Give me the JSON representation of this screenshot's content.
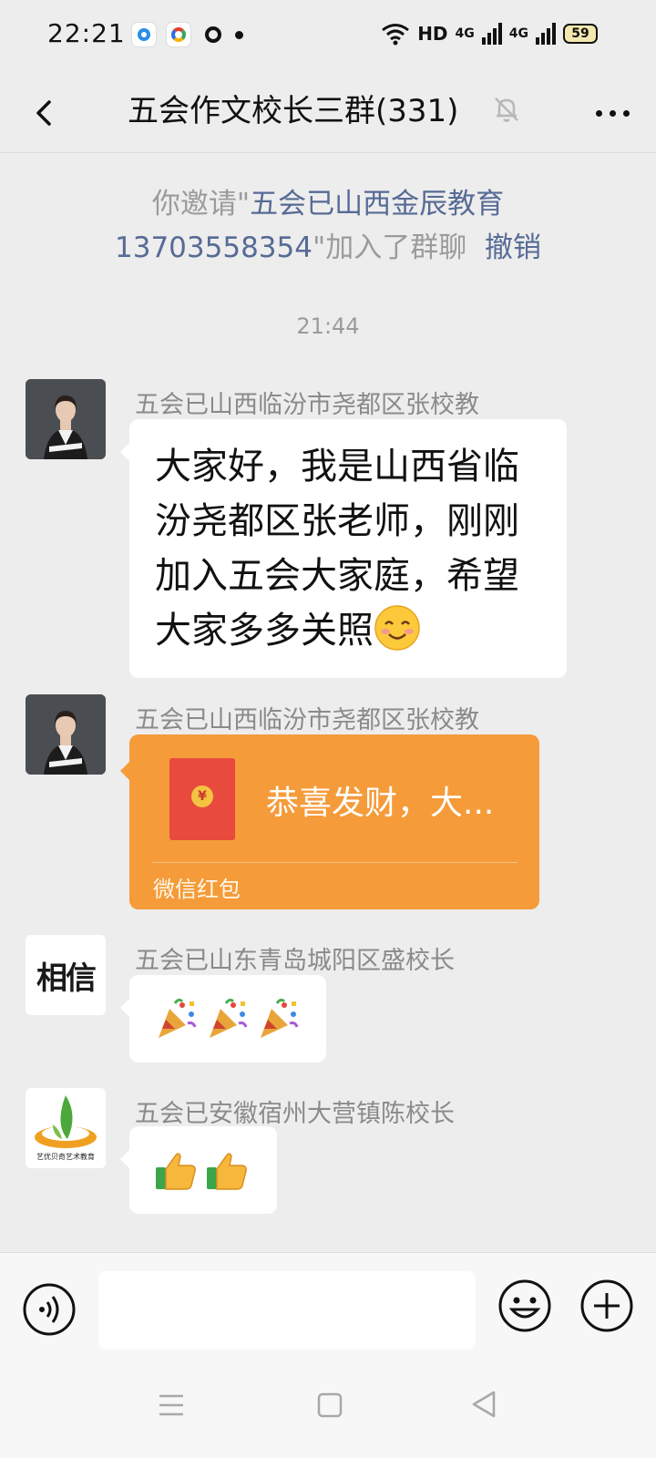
{
  "status_bar": {
    "time": "22:21",
    "network": "HD",
    "net_a": "4G",
    "net_b": "4G",
    "battery": "59"
  },
  "header": {
    "title": "五会作文校长三群(331)"
  },
  "system_message": {
    "prefix": "你邀请\"",
    "invitee": "五会已山西金辰教育13703558354",
    "suffix": "\"加入了群聊",
    "action": "撤销"
  },
  "timestamp": "21:44",
  "messages": [
    {
      "sender": "五会已山西临汾市尧都区张校教",
      "text": "大家好，我是山西省临汾尧都区张老师，刚刚加入五会大家庭，希望大家多多关照"
    },
    {
      "sender": "五会已山西临汾市尧都区张校教",
      "red_packet_title": "恭喜发财，大...",
      "red_packet_label": "微信红包"
    },
    {
      "sender": "五会已山东青岛城阳区盛校长",
      "avatar_text": "相信"
    },
    {
      "sender": "五会已安徽宿州大营镇陈校长",
      "avatar_caption": "艺优贝奇艺术教育"
    }
  ],
  "colors": {
    "background": "#ededed",
    "link": "#576b95",
    "red_packet": "#f59b3a"
  }
}
